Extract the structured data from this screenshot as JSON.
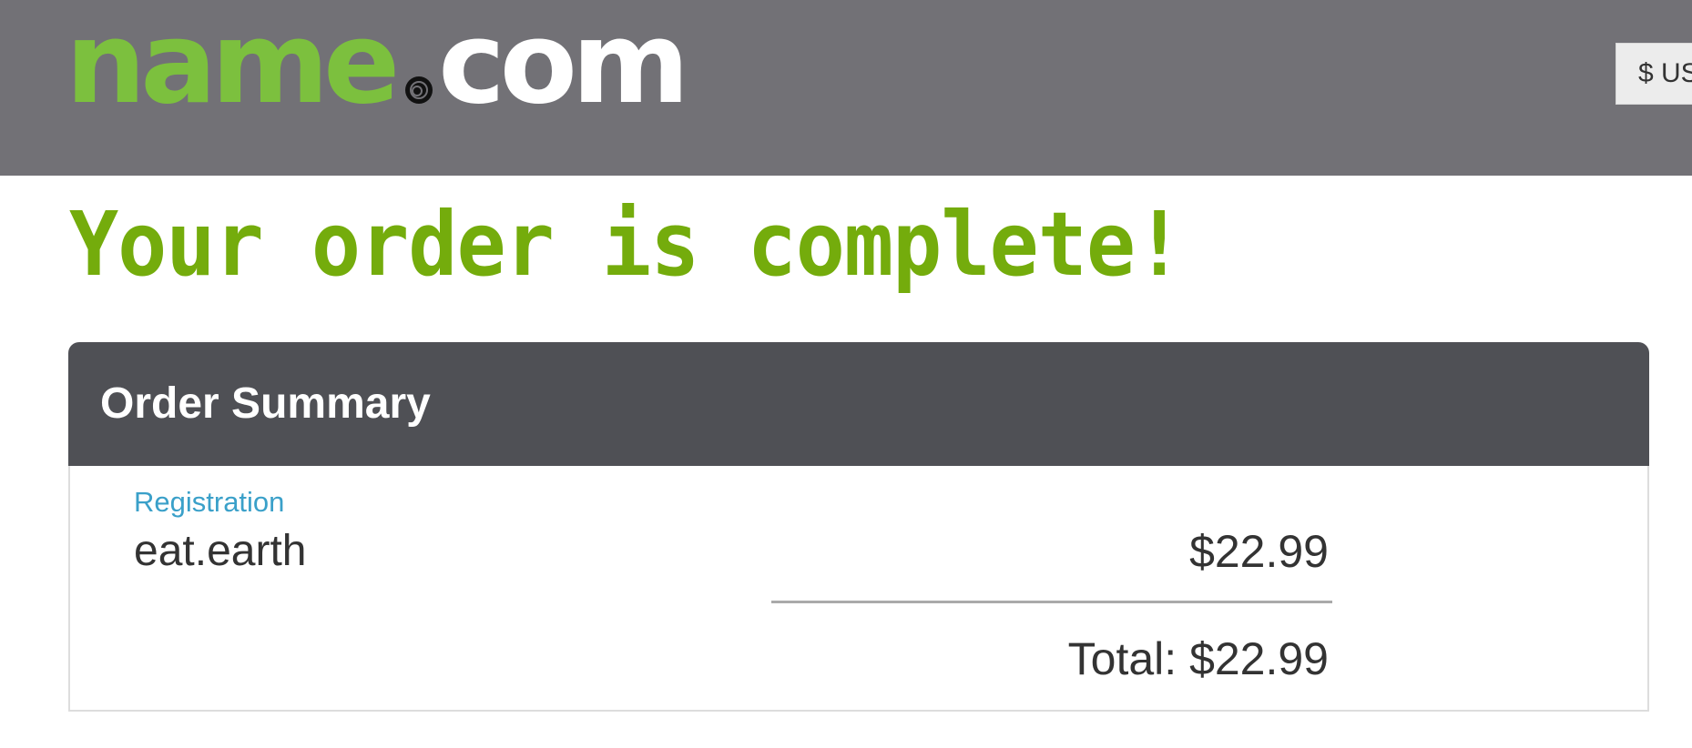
{
  "header": {
    "logo": {
      "name_part": "name",
      "com_part": "com"
    },
    "currency_label": "$ US"
  },
  "main": {
    "title": "Your order is complete!",
    "order_summary": {
      "heading": "Order Summary",
      "items": [
        {
          "type": "Registration",
          "name": "eat.earth",
          "price": "$22.99"
        }
      ],
      "total_label": "Total:",
      "total_value": "$22.99"
    }
  },
  "colors": {
    "header_bg": "#727176",
    "logo_green": "#7cc03e",
    "title_green": "#74ac0c",
    "summary_header_bg": "#4f5055",
    "link_blue": "#3aa0c9"
  }
}
